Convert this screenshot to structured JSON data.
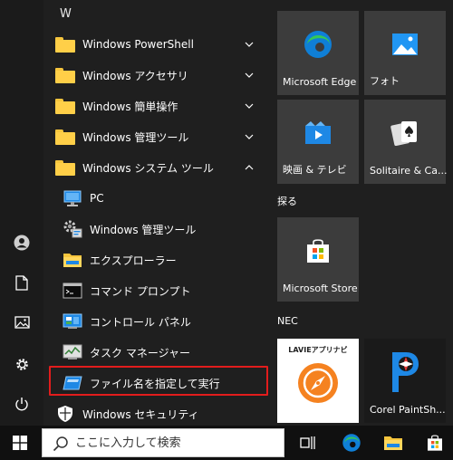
{
  "app_list": {
    "section_letter": "W",
    "items": [
      {
        "label": "Windows PowerShell",
        "kind": "folder",
        "expanded": false
      },
      {
        "label": "Windows アクセサリ",
        "kind": "folder",
        "expanded": false
      },
      {
        "label": "Windows 簡単操作",
        "kind": "folder",
        "expanded": false
      },
      {
        "label": "Windows 管理ツール",
        "kind": "folder",
        "expanded": false
      },
      {
        "label": "Windows システム ツール",
        "kind": "folder",
        "expanded": true
      },
      {
        "label": "PC",
        "kind": "app",
        "icon": "pc-icon"
      },
      {
        "label": "Windows 管理ツール",
        "kind": "app",
        "icon": "admin-tools-icon"
      },
      {
        "label": "エクスプローラー",
        "kind": "app",
        "icon": "file-explorer-icon"
      },
      {
        "label": "コマンド プロンプト",
        "kind": "app",
        "icon": "command-prompt-icon"
      },
      {
        "label": "コントロール パネル",
        "kind": "app",
        "icon": "control-panel-icon"
      },
      {
        "label": "タスク マネージャー",
        "kind": "app",
        "icon": "task-manager-icon"
      },
      {
        "label": "ファイル名を指定して実行",
        "kind": "app",
        "icon": "run-icon",
        "highlighted": true
      },
      {
        "label": "Windows セキュリティ",
        "kind": "app",
        "icon": "shield-icon"
      }
    ]
  },
  "rail": {
    "icons": [
      "user-icon",
      "document-icon",
      "pictures-icon",
      "settings-icon",
      "power-icon"
    ]
  },
  "tiles": {
    "items": [
      {
        "label": "Microsoft Edge",
        "icon": "edge-icon"
      },
      {
        "label": "フォト",
        "icon": "photos-icon"
      },
      {
        "label": "映画 & テレビ",
        "icon": "movies-tv-icon"
      },
      {
        "label": "Solitaire & Ca...",
        "icon": "solitaire-icon"
      },
      {
        "label": "Microsoft Store",
        "icon": "store-icon"
      },
      {
        "label": "",
        "icon": "lavie-app-navi-icon",
        "logo_text": "LAVIEアプリナビ"
      },
      {
        "label": "Corel PaintSh...",
        "icon": "corel-paintshop-icon"
      }
    ],
    "groups": [
      "探る",
      "NEC"
    ]
  },
  "taskbar": {
    "search_placeholder": "ここに入力して検索",
    "icons": [
      "windows-logo-icon",
      "search-icon",
      "task-view-icon",
      "edge-icon",
      "file-explorer-icon",
      "store-icon"
    ]
  },
  "colors": {
    "highlight_border": "#e21c1c",
    "tile_bg": "#3c3c3c",
    "menu_bg": "#1f1f1f",
    "folder": "#ffcf48"
  }
}
